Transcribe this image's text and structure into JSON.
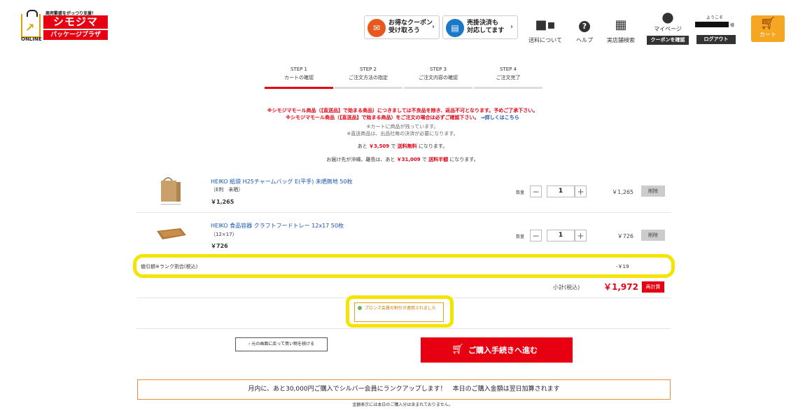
{
  "header": {
    "logo_tagline": "商売繁盛をがっつり支援！",
    "logo_main": "シモジマ",
    "logo_sub": "パッケージプラザ",
    "logo_online": "ONLINE",
    "promos": [
      {
        "line1": "お得なクーポン",
        "line2": "受け取ろう",
        "icon": "coupon-icon",
        "color": "#e8571c"
      },
      {
        "line1": "売掛決済も",
        "line2": "対応してます",
        "icon": "invoice-icon",
        "color": "#1b78c8"
      }
    ],
    "nav": [
      {
        "label": "送料について",
        "icon": "truck-icon"
      },
      {
        "label": "ヘルプ",
        "icon": "help-icon"
      },
      {
        "label": "実店舗検索",
        "icon": "store-icon"
      },
      {
        "label": "マイページ",
        "icon": "user-icon"
      }
    ],
    "coupon_button": "クーポンを確認",
    "welcome": "ようこそ",
    "sama": "様",
    "logout_button": "ログアウト",
    "cart_label": "カート"
  },
  "steps": [
    {
      "num": "STEP 1",
      "label": "カートの確認",
      "active": true
    },
    {
      "num": "STEP 2",
      "label": "ご注文方法の指定",
      "active": false
    },
    {
      "num": "STEP 3",
      "label": "ご注文内容の確認",
      "active": false
    },
    {
      "num": "STEP 4",
      "label": "ご注文完了",
      "active": false
    }
  ],
  "notices": {
    "line1": "※シモジマモール商品（【直送品】で始まる商品）につきましては不良品を除き、返品不可となります。予めご了承下さい。",
    "line2a": "※シモジマモール商品（【直送品】で始まる商品）をご注文の場合は必ずご確認下さい。",
    "line2b": "⇒詳しくはこちら",
    "line3": "※カートに商品が残っています。",
    "line4": "※直送商品は、出品社毎の決済が必要になります。",
    "free1_pre": "あと",
    "free1_amount": "￥3,509",
    "free1_mid": "で",
    "free1_emph": "送料無料",
    "free1_post": "になります。",
    "free2_pre": "お届け先が沖縄、離島は、あと",
    "free2_amount": "￥31,009",
    "free2_mid": "で",
    "free2_emph": "送料半額",
    "free2_post": "になります。"
  },
  "items": [
    {
      "name": "HEIKO 紙袋 H25チャームバッグ E(平手) 未晒無地 50枚",
      "sub": "（E判　未晒）",
      "price": "￥1,265",
      "qty_label": "数量",
      "qty": "1",
      "line_total": "￥1,265",
      "delete": "削除"
    },
    {
      "name": "HEIKO 食品容器 クラフトフードトレー 12x17 50枚",
      "sub": "（12×17）",
      "price": "￥726",
      "qty_label": "数量",
      "qty": "1",
      "line_total": "￥726",
      "delete": "削除"
    }
  ],
  "discount": {
    "label": "値引額※ランク割合(税込)",
    "value": "-￥19"
  },
  "subtotal": {
    "label": "小計(税込)",
    "value": "￥1,972",
    "recalc": "再計算"
  },
  "member_note": "プロンズ会員の割引が適用されました",
  "actions": {
    "back": "‹ 元の画面に戻って買い物を続ける",
    "checkout": "ご購入手続きへ進む"
  },
  "banner": "月内に、あと30,000円ご購入でシルバー会員にランクアップします！　本日のご購入金額は翌日加算されます",
  "banner_note": "金額表示には本日のご購入分は含まれておりません。",
  "colors": {
    "accent": "#e60012",
    "highlight": "#f5e400",
    "cart": "#f5a623"
  }
}
